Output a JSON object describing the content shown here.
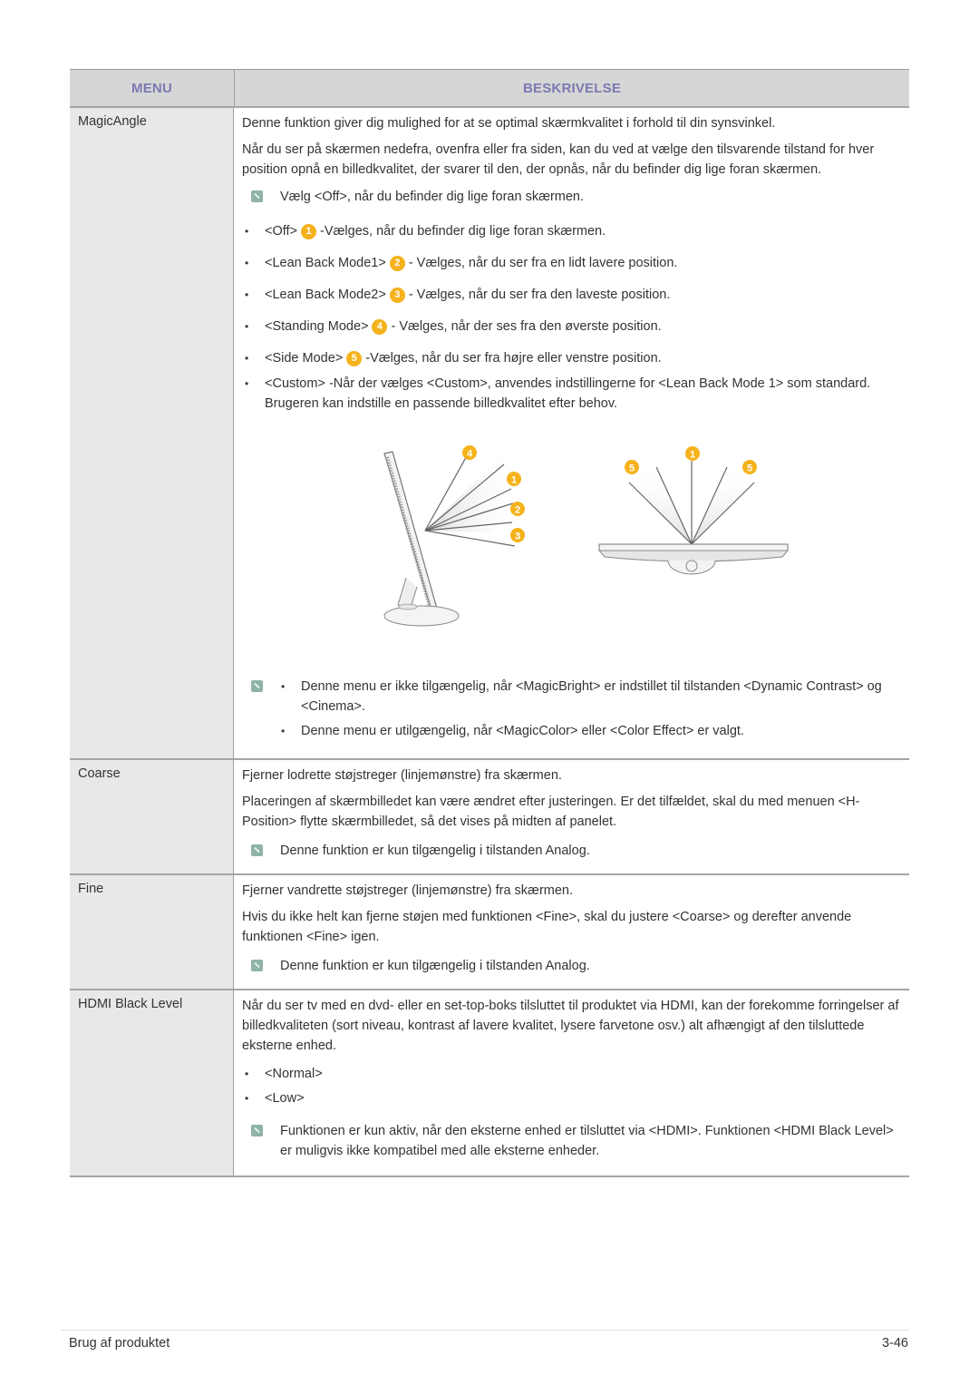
{
  "table": {
    "headers": {
      "menu": "MENU",
      "description": "BESKRIVELSE"
    },
    "header_color": "#7a7ab2",
    "rows": [
      {
        "menu": "MagicAngle",
        "paragraphs": [
          "Denne funktion giver dig mulighed for at se optimal skærmkvalitet i forhold til din synsvinkel.",
          "Når du ser på skærmen nedefra, ovenfra eller fra siden, kan du ved at vælge den tilsvarende tilstand for hver position opnå en billedkvalitet, der svarer til den, der opnås, når du befinder dig lige foran skærmen."
        ],
        "note": "Vælg <Off>, når du befinder dig lige foran skærmen.",
        "modes": [
          {
            "name": "<Off>",
            "badge": "1",
            "text": "-Vælges, når du befinder dig lige foran skærmen."
          },
          {
            "name": "<Lean Back Mode1>",
            "badge": "2",
            "text": "- Vælges, når du ser fra en lidt lavere position."
          },
          {
            "name": "<Lean Back Mode2>",
            "badge": "3",
            "text": "- Vælges, når du ser fra den laveste position."
          },
          {
            "name": "<Standing Mode>",
            "badge": "4",
            "text": "- Vælges, når der ses fra den øverste position."
          },
          {
            "name": "<Side Mode>",
            "badge": "5",
            "text": "-Vælges, når du ser fra højre eller venstre position."
          },
          {
            "name": "<Custom>",
            "badge": "",
            "text": "-Når der vælges <Custom>, anvendes indstillingerne for <Lean Back Mode 1> som standard. Brugeren kan indstille en passende billedkvalitet efter behov."
          }
        ],
        "figure_side_badges": [
          "4",
          "1",
          "2",
          "3"
        ],
        "figure_top_badges": [
          "5",
          "1",
          "5"
        ],
        "badge_color": "#f5b21b",
        "notes_list": [
          "Denne menu er ikke tilgængelig, når <MagicBright> er indstillet til tilstanden <Dynamic Contrast> og <Cinema>.",
          "Denne menu er utilgængelig, når <MagicColor> eller <Color Effect> er valgt."
        ]
      },
      {
        "menu": "Coarse",
        "paragraphs": [
          "Fjerner lodrette støjstreger (linjemønstre) fra skærmen.",
          "Placeringen af skærmbilledet kan være ændret efter justeringen. Er det tilfældet, skal du med menuen <H-Position> flytte skærmbilledet, så det vises på midten af panelet."
        ],
        "note": "Denne funktion er kun tilgængelig i tilstanden Analog."
      },
      {
        "menu": "Fine",
        "paragraphs": [
          "Fjerner vandrette støjstreger (linjemønstre) fra skærmen.",
          "Hvis du ikke helt kan fjerne støjen med funktionen <Fine>, skal du justere <Coarse> og derefter anvende funktionen <Fine> igen."
        ],
        "note": "Denne funktion er kun tilgængelig i tilstanden Analog."
      },
      {
        "menu": "HDMI Black Level",
        "paragraphs": [
          "Når du ser tv med en dvd- eller en set-top-boks tilsluttet til produktet via HDMI, kan der forekomme forringelser af billedkvaliteten (sort niveau, kontrast af lavere kvalitet, lysere farvetone osv.) alt afhængigt af den tilsluttede eksterne enhed."
        ],
        "options": [
          "<Normal>",
          "<Low>"
        ],
        "note": "Funktionen er kun aktiv, når den eksterne enhed er tilsluttet via <HDMI>. Funktionen <HDMI Black Level> er muligvis ikke kompatibel med alle eksterne enheder."
      }
    ]
  },
  "footer": {
    "section": "Brug af produktet",
    "page": "3-46"
  }
}
